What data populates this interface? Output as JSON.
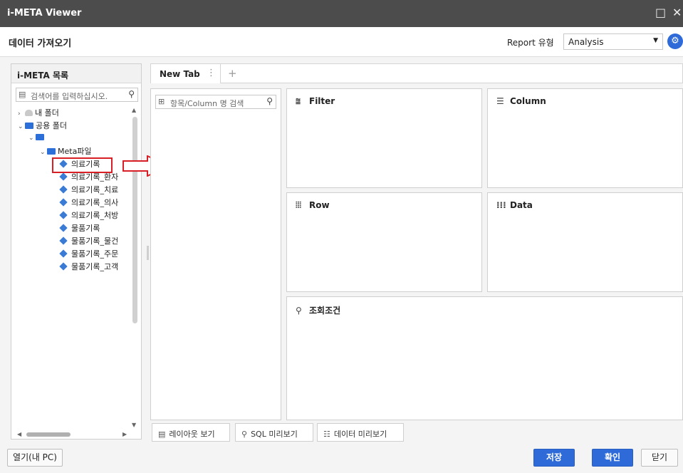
{
  "window": {
    "title": "i-META Viewer",
    "maximize_glyph": "□",
    "close_glyph": "✕"
  },
  "header": {
    "dialog_title": "데이터 가져오기",
    "report_type_label": "Report 유형",
    "report_type_value": "Analysis",
    "settings_icon": "gear-icon"
  },
  "left_panel": {
    "title": "i-META 목록",
    "search_placeholder": "검색어를 입력하십시오.",
    "tree": [
      {
        "label": "내 폴더",
        "type": "user",
        "chevron": "›"
      },
      {
        "label": "공용 폴더",
        "type": "folder",
        "chevron": "⌄"
      },
      {
        "label": "",
        "type": "folder",
        "chevron": "⌄"
      },
      {
        "label": "Meta파일",
        "type": "folder",
        "chevron": "⌄"
      },
      {
        "label": "의료기록",
        "type": "meta"
      },
      {
        "label": "의료기록_환자",
        "type": "meta"
      },
      {
        "label": "의료기록_치료",
        "type": "meta"
      },
      {
        "label": "의료기록_의사",
        "type": "meta"
      },
      {
        "label": "의료기록_처방",
        "type": "meta"
      },
      {
        "label": "물품기록",
        "type": "meta"
      },
      {
        "label": "물품기록_물건",
        "type": "meta"
      },
      {
        "label": "물품기록_주문",
        "type": "meta"
      },
      {
        "label": "물품기록_고객",
        "type": "meta"
      }
    ]
  },
  "tabs": {
    "items": [
      {
        "label": "New Tab",
        "menu_glyph": "⋮"
      }
    ],
    "add_glyph": "+"
  },
  "column_panel": {
    "search_placeholder": "항목/Column 명 검색"
  },
  "drop_zones": {
    "filter": {
      "label": "Filter",
      "glyph": "⩰"
    },
    "column": {
      "label": "Column",
      "glyph": "☰"
    },
    "row": {
      "label": "Row",
      "glyph": "⦙⦙⦙"
    },
    "data": {
      "label": "Data",
      "glyph": "⁝⁝⁝"
    },
    "condition": {
      "label": "조회조건",
      "glyph": "⚲"
    }
  },
  "bottom_tabs": {
    "layout": {
      "label": "레이아웃 보기",
      "glyph": "▤"
    },
    "sql": {
      "label": "SQL 미리보기",
      "glyph": "⚲"
    },
    "data": {
      "label": "데이터 미리보기",
      "glyph": "☷"
    }
  },
  "footer": {
    "open_label": "열기(내 PC)",
    "save_label": "저장",
    "ok_label": "확인",
    "close_label": "닫기"
  },
  "colors": {
    "accent": "#2f6bd8",
    "highlight": "#d81f26",
    "titlebar": "#4c4c4c"
  }
}
